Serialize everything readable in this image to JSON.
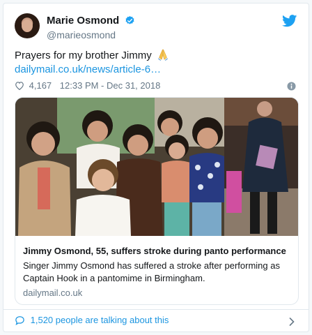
{
  "user": {
    "display_name": "Marie Osmond",
    "handle": "@marieosmond"
  },
  "tweet": {
    "text": "Prayers for my brother Jimmy",
    "link_text": "dailymail.co.uk/news/article-6…",
    "likes": "4,167",
    "timestamp": "12:33 PM - Dec 31, 2018"
  },
  "link_card": {
    "title": "Jimmy Osmond, 55, suffers stroke during panto performance",
    "description": "Singer Jimmy Osmond has suffered a stroke after performing as Captain Hook in a pantomime in Birmingham.",
    "domain": "dailymail.co.uk"
  },
  "footer": {
    "talking_text": "1,520 people are talking about this"
  },
  "colors": {
    "twitter_blue": "#1da1f2",
    "link_blue": "#1b95e0",
    "secondary_text": "#657786",
    "border": "#e1e8ed"
  },
  "icons": [
    "verified-badge-icon",
    "twitter-bird-icon",
    "folded-hands-icon",
    "heart-icon",
    "info-icon",
    "comment-icon",
    "chevron-right-icon"
  ]
}
